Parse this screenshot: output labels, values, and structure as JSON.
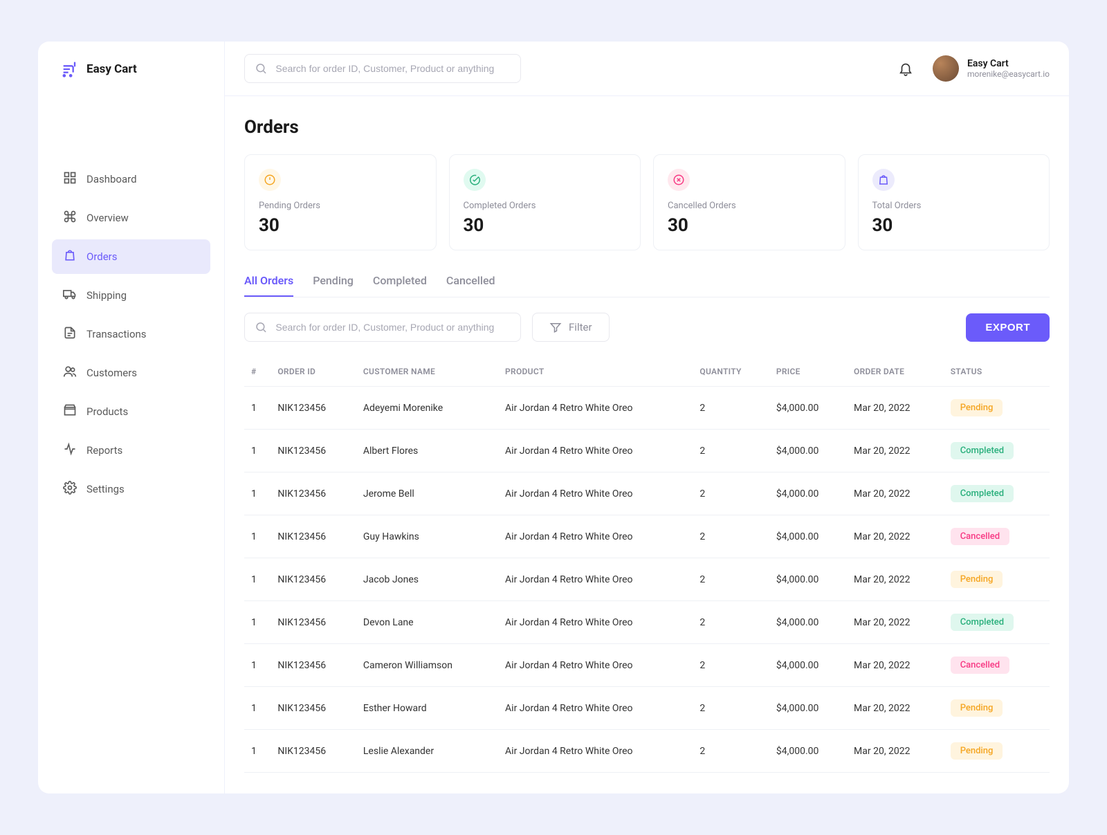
{
  "brand": "Easy Cart",
  "search_placeholder": "Search for order ID, Customer, Product or anything",
  "user": {
    "name": "Easy Cart",
    "email": "morenike@easycart.io"
  },
  "sidebar": {
    "items": [
      {
        "label": "Dashboard",
        "icon": "grid"
      },
      {
        "label": "Overview",
        "icon": "command"
      },
      {
        "label": "Orders",
        "icon": "bag",
        "active": true
      },
      {
        "label": "Shipping",
        "icon": "truck"
      },
      {
        "label": "Transactions",
        "icon": "file"
      },
      {
        "label": "Customers",
        "icon": "users"
      },
      {
        "label": "Products",
        "icon": "box"
      },
      {
        "label": "Reports",
        "icon": "activity"
      },
      {
        "label": "Settings",
        "icon": "gear"
      }
    ]
  },
  "page": {
    "title": "Orders"
  },
  "stats": [
    {
      "label": "Pending Orders",
      "value": "30",
      "kind": "pending"
    },
    {
      "label": "Completed Orders",
      "value": "30",
      "kind": "completed"
    },
    {
      "label": "Cancelled Orders",
      "value": "30",
      "kind": "cancelled"
    },
    {
      "label": "Total Orders",
      "value": "30",
      "kind": "total"
    }
  ],
  "tabs": [
    {
      "label": "All Orders",
      "active": true
    },
    {
      "label": "Pending"
    },
    {
      "label": "Completed"
    },
    {
      "label": "Cancelled"
    }
  ],
  "filter_label": "Filter",
  "export_label": "EXPORT",
  "table": {
    "columns": [
      "#",
      "ORDER ID",
      "CUSTOMER NAME",
      "PRODUCT",
      "QUANTITY",
      "PRICE",
      "ORDER DATE",
      "STATUS"
    ],
    "rows": [
      {
        "n": "1",
        "order_id": "NIK123456",
        "customer": "Adeyemi Morenike",
        "product": "Air Jordan 4 Retro White Oreo",
        "qty": "2",
        "price": "$4,000.00",
        "date": "Mar 20, 2022",
        "status": "Pending"
      },
      {
        "n": "1",
        "order_id": "NIK123456",
        "customer": "Albert Flores",
        "product": "Air Jordan 4 Retro White Oreo",
        "qty": "2",
        "price": "$4,000.00",
        "date": "Mar 20, 2022",
        "status": "Completed"
      },
      {
        "n": "1",
        "order_id": "NIK123456",
        "customer": "Jerome Bell",
        "product": "Air Jordan 4 Retro White Oreo",
        "qty": "2",
        "price": "$4,000.00",
        "date": "Mar 20, 2022",
        "status": "Completed"
      },
      {
        "n": "1",
        "order_id": "NIK123456",
        "customer": "Guy Hawkins",
        "product": "Air Jordan 4 Retro White Oreo",
        "qty": "2",
        "price": "$4,000.00",
        "date": "Mar 20, 2022",
        "status": "Cancelled"
      },
      {
        "n": "1",
        "order_id": "NIK123456",
        "customer": "Jacob Jones",
        "product": "Air Jordan 4 Retro White Oreo",
        "qty": "2",
        "price": "$4,000.00",
        "date": "Mar 20, 2022",
        "status": "Pending"
      },
      {
        "n": "1",
        "order_id": "NIK123456",
        "customer": "Devon Lane",
        "product": "Air Jordan 4 Retro White Oreo",
        "qty": "2",
        "price": "$4,000.00",
        "date": "Mar 20, 2022",
        "status": "Completed"
      },
      {
        "n": "1",
        "order_id": "NIK123456",
        "customer": "Cameron Williamson",
        "product": "Air Jordan 4 Retro White Oreo",
        "qty": "2",
        "price": "$4,000.00",
        "date": "Mar 20, 2022",
        "status": "Cancelled"
      },
      {
        "n": "1",
        "order_id": "NIK123456",
        "customer": "Esther Howard",
        "product": "Air Jordan 4 Retro White Oreo",
        "qty": "2",
        "price": "$4,000.00",
        "date": "Mar 20, 2022",
        "status": "Pending"
      },
      {
        "n": "1",
        "order_id": "NIK123456",
        "customer": "Leslie Alexander",
        "product": "Air Jordan 4 Retro White Oreo",
        "qty": "2",
        "price": "$4,000.00",
        "date": "Mar 20, 2022",
        "status": "Pending"
      }
    ]
  }
}
